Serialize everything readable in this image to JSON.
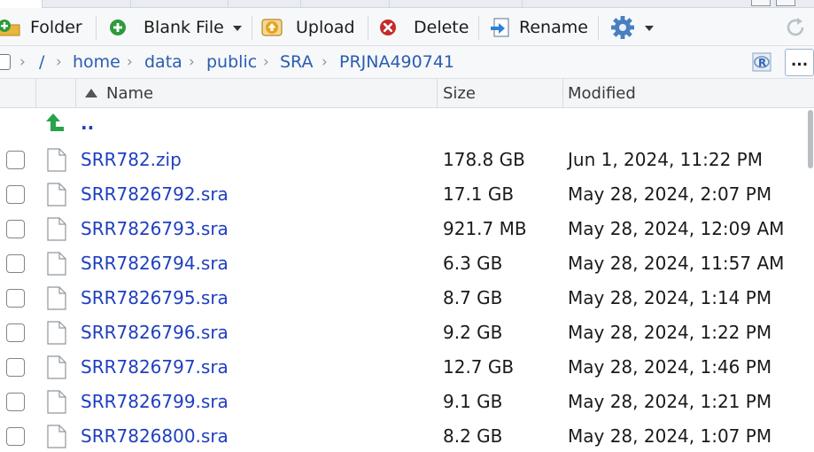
{
  "toolbar": {
    "folder_label": "Folder",
    "blank_file_label": "Blank File",
    "upload_label": "Upload",
    "delete_label": "Delete",
    "rename_label": "Rename",
    "folder_icon": "new-folder-icon",
    "blank_file_icon": "new-blank-file-icon",
    "upload_icon": "upload-icon",
    "delete_icon": "delete-icon",
    "rename_icon": "rename-icon",
    "more_icon": "gear-icon",
    "refresh_icon": "refresh-icon"
  },
  "breadcrumb": {
    "root": "/",
    "segments": [
      "home",
      "data",
      "public",
      "SRA",
      "PRJNA490741"
    ],
    "project_icon": "r-project-icon",
    "more_label": "..."
  },
  "table": {
    "columns": {
      "name": "Name",
      "size": "Size",
      "modified": "Modified"
    },
    "sort": {
      "column": "Name",
      "direction": "ascending"
    },
    "up_entry": "..",
    "rows": [
      {
        "name": "SRR782.zip",
        "size": "178.8 GB",
        "modified": "Jun 1, 2024, 11:22 PM"
      },
      {
        "name": "SRR7826792.sra",
        "size": "17.1 GB",
        "modified": "May 28, 2024, 2:07 PM"
      },
      {
        "name": "SRR7826793.sra",
        "size": "921.7 MB",
        "modified": "May 28, 2024, 12:09 AM"
      },
      {
        "name": "SRR7826794.sra",
        "size": "6.3 GB",
        "modified": "May 28, 2024, 11:57 AM"
      },
      {
        "name": "SRR7826795.sra",
        "size": "8.7 GB",
        "modified": "May 28, 2024, 1:14 PM"
      },
      {
        "name": "SRR7826796.sra",
        "size": "9.2 GB",
        "modified": "May 28, 2024, 1:22 PM"
      },
      {
        "name": "SRR7826797.sra",
        "size": "12.7 GB",
        "modified": "May 28, 2024, 1:46 PM"
      },
      {
        "name": "SRR7826799.sra",
        "size": "9.1 GB",
        "modified": "May 28, 2024, 1:21 PM"
      },
      {
        "name": "SRR7826800.sra",
        "size": "8.2 GB",
        "modified": "May 28, 2024, 1:07 PM"
      }
    ]
  },
  "colors": {
    "link": "#1f3fbf",
    "breadcrumb_link": "#2a5db0",
    "toolbar_bg": "#f7f8fa",
    "header_bg": "#f3f5f7",
    "add_green": "#2e9a3c",
    "delete_red": "#c62a2a",
    "upload_orange": "#e8a21a",
    "up_arrow_green": "#27a34a"
  }
}
